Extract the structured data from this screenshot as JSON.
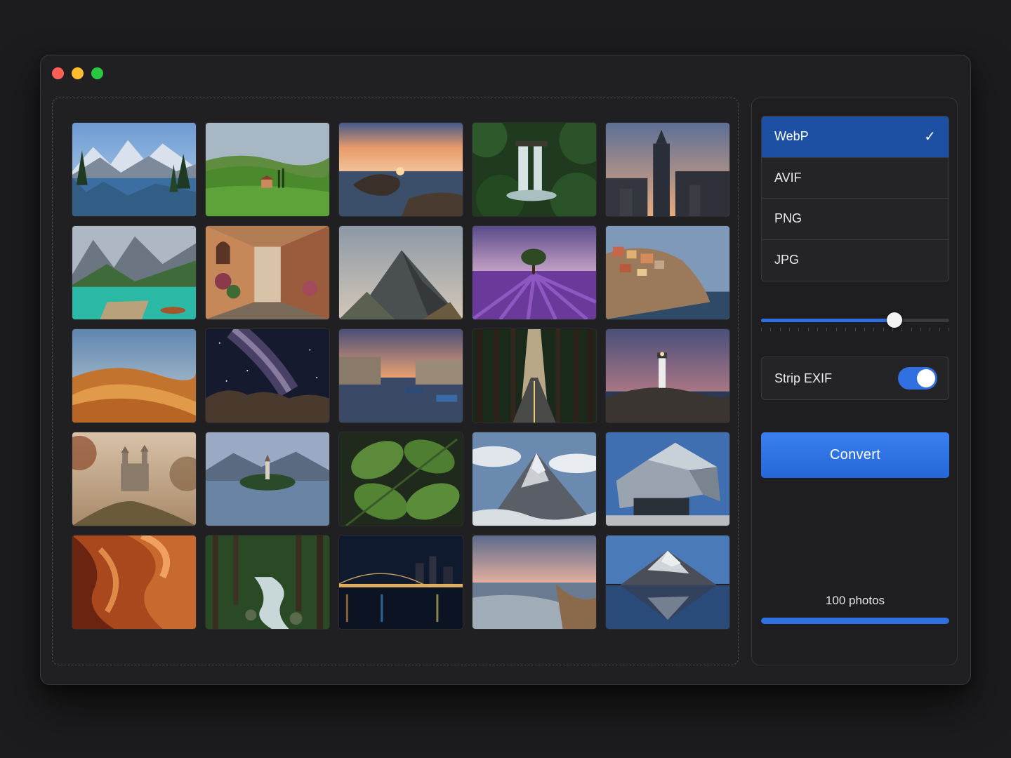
{
  "window": {
    "controls": [
      "close",
      "minimize",
      "zoom"
    ]
  },
  "photos": [
    {
      "name": "mountain-lake-forest"
    },
    {
      "name": "green-hills-villa"
    },
    {
      "name": "rocky-coast-sunset"
    },
    {
      "name": "jungle-waterfall"
    },
    {
      "name": "city-skyline-dusk"
    },
    {
      "name": "turquoise-lake-dock"
    },
    {
      "name": "old-town-alley"
    },
    {
      "name": "misty-peak"
    },
    {
      "name": "lavender-field-tree"
    },
    {
      "name": "cliffside-village"
    },
    {
      "name": "desert-dunes"
    },
    {
      "name": "milky-way-rocks"
    },
    {
      "name": "canal-city-dusk"
    },
    {
      "name": "forest-road"
    },
    {
      "name": "lighthouse-sunset"
    },
    {
      "name": "foggy-castle"
    },
    {
      "name": "island-lake-church"
    },
    {
      "name": "green-leaves"
    },
    {
      "name": "alpine-summit-clouds"
    },
    {
      "name": "modern-architecture"
    },
    {
      "name": "slot-canyon"
    },
    {
      "name": "forest-stream"
    },
    {
      "name": "bridge-night"
    },
    {
      "name": "beach-waves-sunset"
    },
    {
      "name": "snow-mountain-reflection"
    }
  ],
  "formats": {
    "items": [
      {
        "label": "WebP",
        "selected": true
      },
      {
        "label": "AVIF",
        "selected": false
      },
      {
        "label": "PNG",
        "selected": false
      },
      {
        "label": "JPG",
        "selected": false
      }
    ],
    "check_icon": "check-icon",
    "check_glyph": "✓"
  },
  "quality_slider": {
    "value": 0.71
  },
  "strip_exif": {
    "label": "Strip EXIF",
    "enabled": true
  },
  "convert": {
    "label": "Convert"
  },
  "status": {
    "count_label": "100 photos",
    "progress": 1.0
  },
  "colors": {
    "accent": "#2f6fe0",
    "selected": "#1d4fa3",
    "background": "#1c1c1e"
  }
}
